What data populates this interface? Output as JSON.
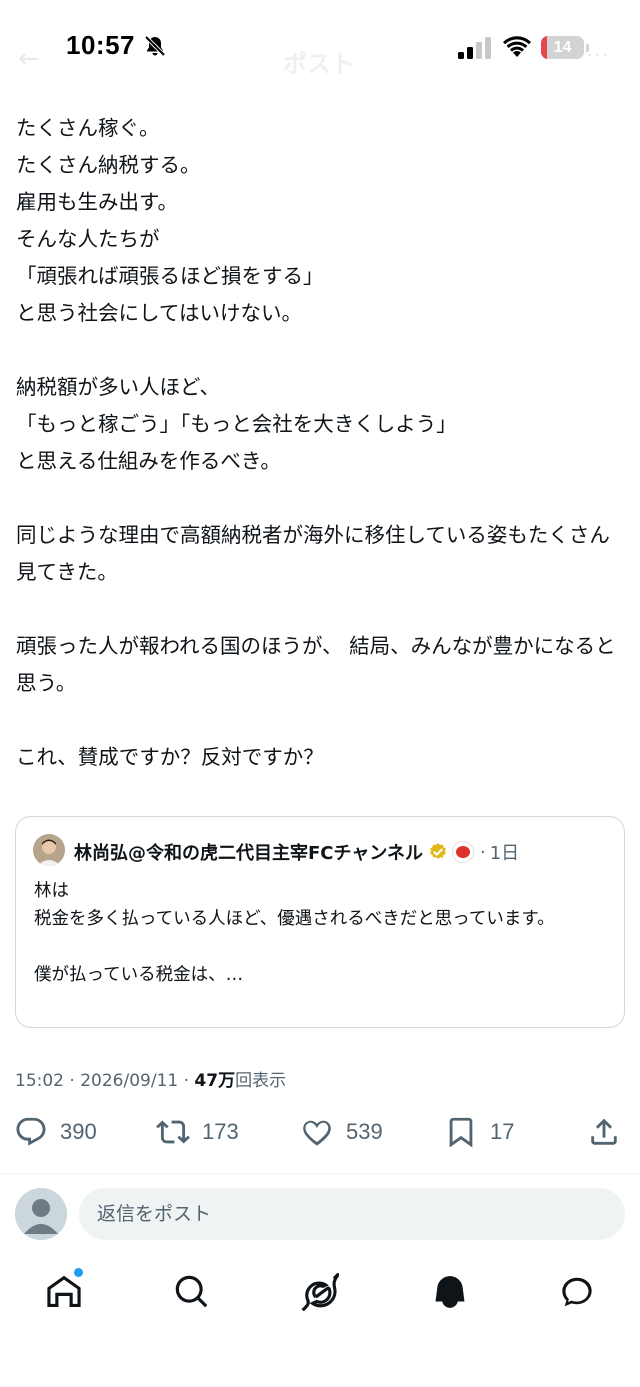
{
  "status_bar": {
    "time": "10:57",
    "battery_level": 14,
    "battery_label": "14",
    "faded_header_title": "ポスト",
    "faded_back": "←",
    "faded_more": "···"
  },
  "post": {
    "lines": [
      "たくさん稼ぐ。",
      "たくさん納税する。",
      "雇用も生み出す。",
      "そんな人たちが",
      "「頑張れば頑張るほど損をする」",
      "と思う社会にしてはいけない。",
      "",
      "納税額が多い人ほど、",
      "「もっと稼ごう」「もっと会社を大きくしよう」",
      "と思える仕組みを作るべき。",
      "",
      "同じような理由で高額納税者が海外に移住している姿もたくさん見てきた。",
      "",
      "頑張った人が報われる国のほうが、 結局、みんなが豊かになると思う。",
      "",
      "これ、賛成ですか？反対ですか？"
    ]
  },
  "quote": {
    "author_name": "林尚弘@令和の虎二代目主宰FCチャンネル",
    "separator": "·",
    "time_ago": "1日",
    "text_line1": "林は",
    "text_line2": "税金を多く払っている人ほど、優遇されるべきだと思っています。",
    "text_line3": "僕が払っている税金は、…"
  },
  "meta": {
    "time": "15:02",
    "sep1": " · ",
    "date": "2026/09/11",
    "sep2": " · ",
    "views": "47万",
    "views_label": "回表示"
  },
  "actions": {
    "replies": "390",
    "reposts": "173",
    "likes": "539",
    "bookmarks": "17"
  },
  "reply": {
    "placeholder": "返信をポスト"
  },
  "colors": {
    "text": "#0f1419",
    "secondary": "#536471",
    "accent": "#1d9bf0",
    "verified_gold": "#e2b719",
    "battery_red": "#e5484d"
  },
  "icons": {
    "reply": "reply-icon",
    "repost": "repost-icon",
    "like": "like-icon",
    "bookmark": "bookmark-icon",
    "share": "share-icon",
    "home": "home-icon",
    "search": "search-icon",
    "grok": "grok-icon",
    "notifications": "bell-icon",
    "messages": "messages-icon"
  }
}
